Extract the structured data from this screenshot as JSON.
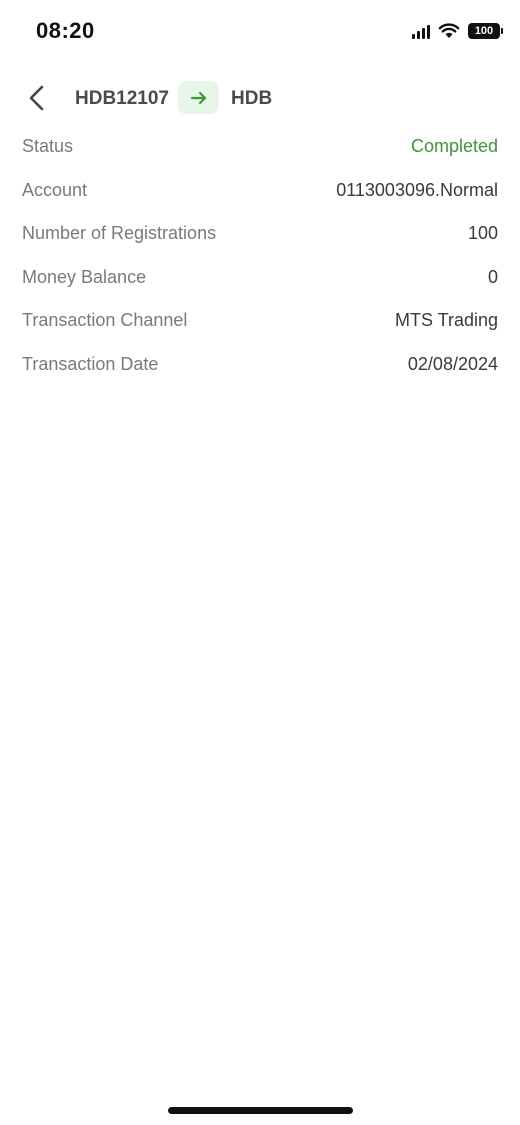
{
  "status_bar": {
    "time": "08:20",
    "battery": "100",
    "icons": [
      "signal-icon",
      "wifi-icon",
      "battery-icon"
    ]
  },
  "header": {
    "back_icon": "chevron-left-icon",
    "from": "HDB12107",
    "arrow_icon": "arrow-right-icon",
    "to": "HDB"
  },
  "details": {
    "status": {
      "label": "Status",
      "value": "Completed"
    },
    "account": {
      "label": "Account",
      "value": "0113003096.Normal"
    },
    "registrations": {
      "label": "Number of Registrations",
      "value": "100"
    },
    "money_balance": {
      "label": "Money Balance",
      "value": "0"
    },
    "channel": {
      "label": "Transaction Channel",
      "value": "MTS Trading"
    },
    "date": {
      "label": "Transaction Date",
      "value": "02/08/2024"
    }
  },
  "colors": {
    "accent_green": "#3a9a35",
    "chip_background": "#e8f5e9",
    "label_gray": "#7a7a7a",
    "value_dark": "#3a3a3a"
  }
}
